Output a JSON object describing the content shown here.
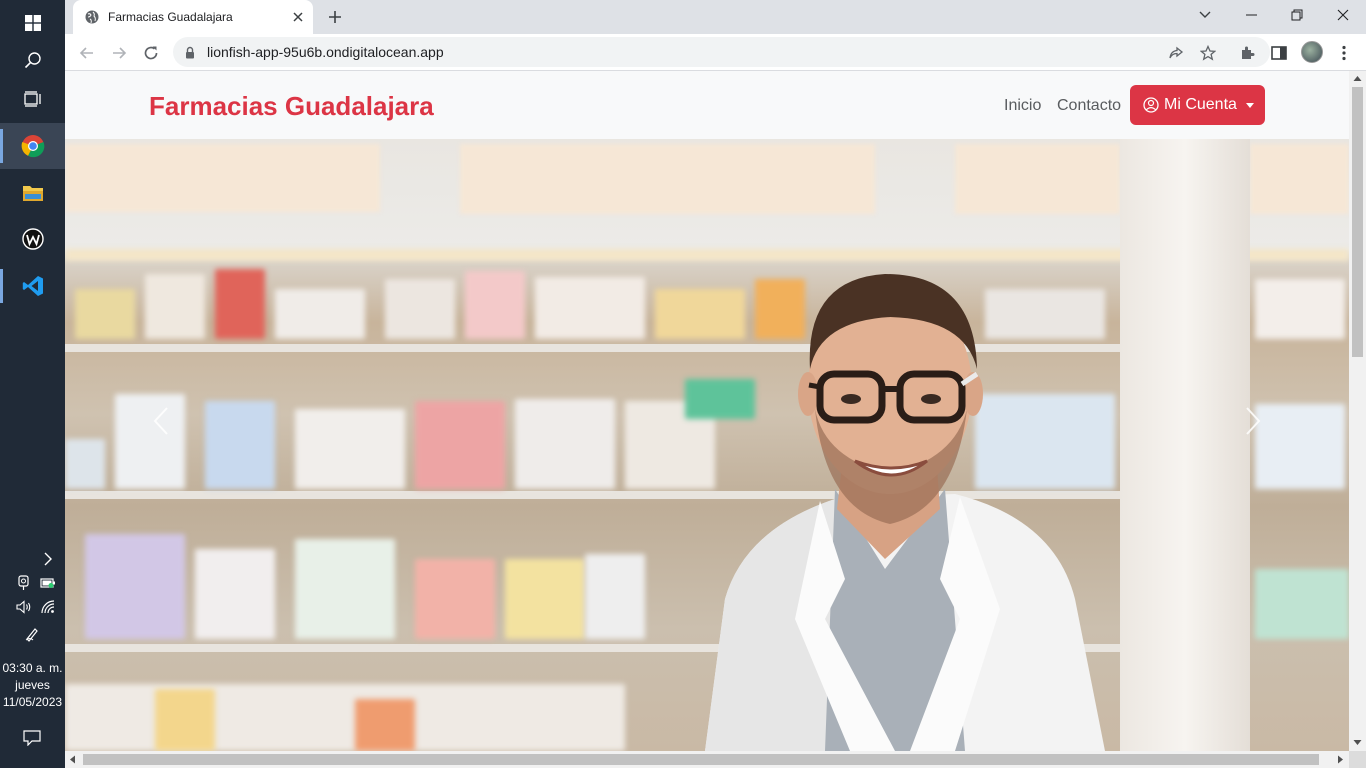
{
  "taskbar": {
    "clock_time": "03:30 a. m.",
    "clock_day": "jueves",
    "clock_date": "11/05/2023",
    "apps": [
      "windows-start",
      "search",
      "task-view",
      "chrome",
      "file-explorer",
      "wamp",
      "vscode"
    ]
  },
  "browser": {
    "tab_title": "Farmacias Guadalajara",
    "url": "lionfish-app-95u6b.ondigitalocean.app"
  },
  "site": {
    "brand": "Farmacias Guadalajara",
    "nav": {
      "home": "Inicio",
      "contact": "Contacto",
      "account": "Mi Cuenta"
    },
    "colors": {
      "brand": "#dc3545",
      "navbar_bg": "#f8f9fa"
    }
  }
}
